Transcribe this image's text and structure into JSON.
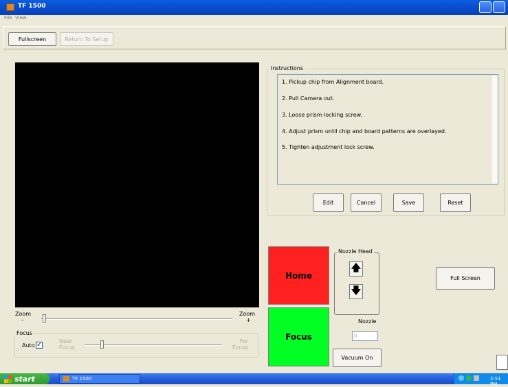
{
  "window": {
    "title": "TF 1500"
  },
  "menu": {
    "items": [
      "File",
      "View"
    ]
  },
  "toolbar": {
    "fullscreen_label": "Fullscreen",
    "return_label": "Return To Setup"
  },
  "zoom": {
    "left_label": "Zoom",
    "left_sign": "-",
    "right_label": "Zoom",
    "right_sign": "+"
  },
  "focus": {
    "legend": "Focus",
    "auto_label": "Auto",
    "auto_checked": true,
    "near_label": "Near\nFocus",
    "far_label": "Far\nFocus"
  },
  "instructions": {
    "legend": "Instructions",
    "steps": [
      "1. Pickup chip from Alignment board.",
      "2. Pull Camera out.",
      "3. Loose prism locking screw.",
      "4. Adjust prism until chip and board patterns are overlayed.",
      "5. Tighten adjustment lock screw."
    ],
    "edit_label": "Edit",
    "cancel_label": "Cancel",
    "save_label": "Save",
    "reset_label": "Reset"
  },
  "controls": {
    "home_label": "Home",
    "focus_label": "Focus",
    "nozzle_head_legend": "Nozzle Head",
    "nozzle_label": "Nozzle",
    "nozzle_value": "0",
    "vacuum_label": "Vacuum On",
    "full_screen_label": "Full Screen"
  },
  "taskbar": {
    "start_label": "start",
    "task_label": "TF 1500",
    "clock": "2:51 PM"
  },
  "colors": {
    "home": "#ff2020",
    "focus": "#00ff22",
    "titlebar": "#0a5fe0"
  }
}
